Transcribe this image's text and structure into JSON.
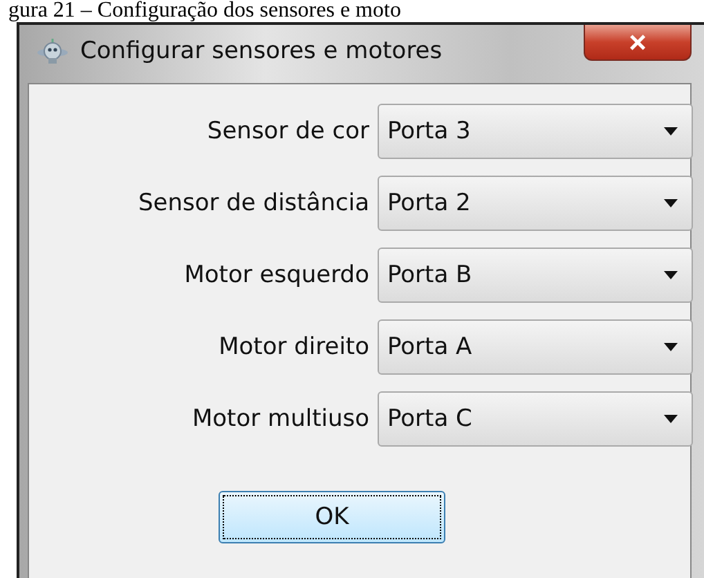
{
  "caption": "gura 21 – Configuração dos sensores e moto",
  "window": {
    "title": "Configurar sensores e motores",
    "close": "×"
  },
  "fields": [
    {
      "label": "Sensor de cor",
      "value": "Porta 3"
    },
    {
      "label": "Sensor de distância",
      "value": "Porta 2"
    },
    {
      "label": "Motor esquerdo",
      "value": "Porta B"
    },
    {
      "label": "Motor direito",
      "value": "Porta A"
    },
    {
      "label": "Motor multiuso",
      "value": "Porta C"
    }
  ],
  "buttons": [
    {
      "label": "OK",
      "focused": true
    }
  ]
}
